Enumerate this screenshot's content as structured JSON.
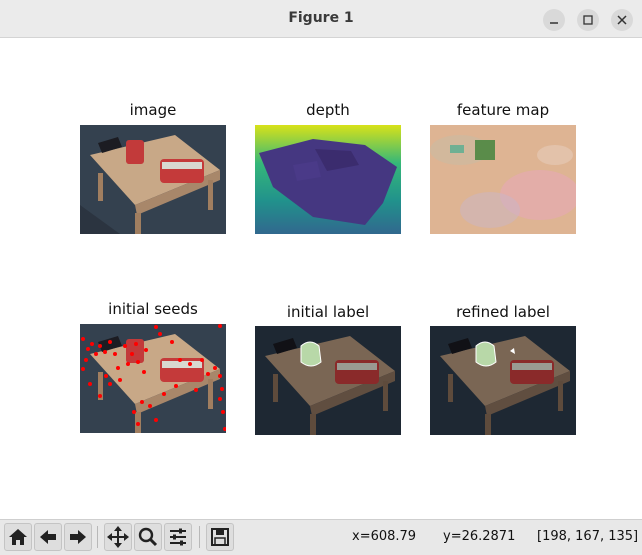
{
  "window": {
    "title": "Figure 1"
  },
  "figure": {
    "panels": [
      {
        "title": "image"
      },
      {
        "title": "depth"
      },
      {
        "title": "feature map"
      },
      {
        "title": "initial seeds"
      },
      {
        "title": "initial label"
      },
      {
        "title": "refined label"
      }
    ]
  },
  "toolbar": {
    "icons": [
      "home-icon",
      "back-arrow-icon",
      "forward-arrow-icon",
      "pan-icon",
      "zoom-icon",
      "configure-subplots-icon",
      "save-icon"
    ]
  },
  "status": {
    "x": "x=608.79",
    "y": "y=26.2871",
    "rgb": "[198, 167, 135]"
  }
}
